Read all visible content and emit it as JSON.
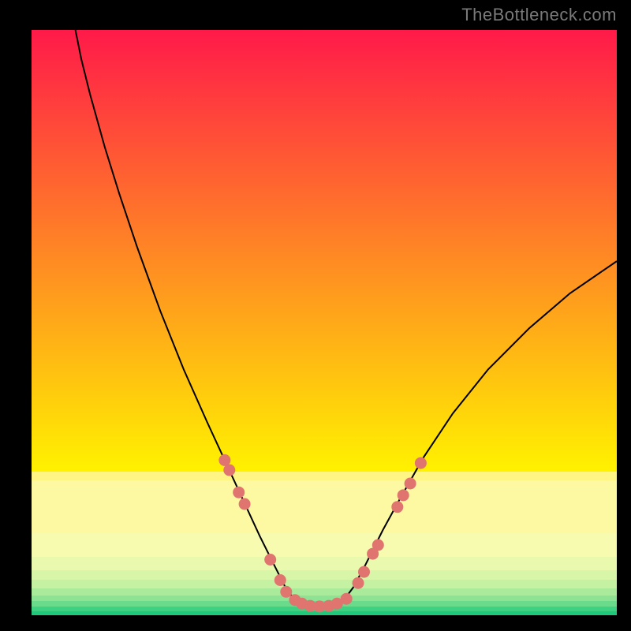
{
  "watermark": "TheBottleneck.com",
  "chart_data": {
    "type": "line",
    "title": "",
    "xlabel": "",
    "ylabel": "",
    "x_range": [
      0,
      100
    ],
    "ylim": [
      0,
      100
    ],
    "background_gradient_top": {
      "top_color": "#ff1a49",
      "bottom_color": "#fff200",
      "top_pct": 0,
      "bottom_pct": 75.5
    },
    "bottom_bands": [
      {
        "color": "#fff585",
        "top_pct": 75.5,
        "bottom_pct": 77.0
      },
      {
        "color": "#fdf9a3",
        "top_pct": 77.0,
        "bottom_pct": 86.0
      },
      {
        "color": "#f6fbb0",
        "top_pct": 86.0,
        "bottom_pct": 90.0
      },
      {
        "color": "#e9faae",
        "top_pct": 90.0,
        "bottom_pct": 92.3
      },
      {
        "color": "#d7f6a8",
        "top_pct": 92.3,
        "bottom_pct": 94.0
      },
      {
        "color": "#c4f2a2",
        "top_pct": 94.0,
        "bottom_pct": 95.4
      },
      {
        "color": "#aaea9b",
        "top_pct": 95.4,
        "bottom_pct": 96.6
      },
      {
        "color": "#8de393",
        "top_pct": 96.6,
        "bottom_pct": 97.6
      },
      {
        "color": "#6adb8b",
        "top_pct": 97.6,
        "bottom_pct": 98.5
      },
      {
        "color": "#3fd182",
        "top_pct": 98.5,
        "bottom_pct": 99.3
      },
      {
        "color": "#1fc97c",
        "top_pct": 99.3,
        "bottom_pct": 100
      }
    ],
    "series": [
      {
        "name": "bottleneck-curve",
        "color": "#000000",
        "stroke_width": 2.0,
        "points": [
          {
            "x": 7.5,
            "y": 100.0
          },
          {
            "x": 8.5,
            "y": 95.0
          },
          {
            "x": 10.0,
            "y": 89.0
          },
          {
            "x": 12.5,
            "y": 80.0
          },
          {
            "x": 15.0,
            "y": 72.0
          },
          {
            "x": 18.0,
            "y": 63.0
          },
          {
            "x": 22.0,
            "y": 52.0
          },
          {
            "x": 26.0,
            "y": 42.0
          },
          {
            "x": 30.0,
            "y": 33.0
          },
          {
            "x": 33.0,
            "y": 26.5
          },
          {
            "x": 36.0,
            "y": 20.0
          },
          {
            "x": 39.0,
            "y": 13.5
          },
          {
            "x": 41.5,
            "y": 8.5
          },
          {
            "x": 43.5,
            "y": 4.5
          },
          {
            "x": 45.0,
            "y": 2.6
          },
          {
            "x": 46.5,
            "y": 1.8
          },
          {
            "x": 48.0,
            "y": 1.5
          },
          {
            "x": 50.0,
            "y": 1.5
          },
          {
            "x": 52.0,
            "y": 1.8
          },
          {
            "x": 53.5,
            "y": 2.8
          },
          {
            "x": 55.0,
            "y": 4.8
          },
          {
            "x": 57.0,
            "y": 8.5
          },
          {
            "x": 60.0,
            "y": 14.5
          },
          {
            "x": 63.0,
            "y": 20.0
          },
          {
            "x": 67.0,
            "y": 27.0
          },
          {
            "x": 72.0,
            "y": 34.5
          },
          {
            "x": 78.0,
            "y": 42.0
          },
          {
            "x": 85.0,
            "y": 49.0
          },
          {
            "x": 92.0,
            "y": 55.0
          },
          {
            "x": 100.0,
            "y": 60.5
          }
        ]
      }
    ],
    "scatter": {
      "name": "data-points",
      "color": "#e0746f",
      "radius": 7.5,
      "points": [
        {
          "x": 33.0,
          "y": 26.5
        },
        {
          "x": 33.8,
          "y": 24.8
        },
        {
          "x": 35.4,
          "y": 21.0
        },
        {
          "x": 36.4,
          "y": 19.0
        },
        {
          "x": 40.8,
          "y": 9.5
        },
        {
          "x": 42.5,
          "y": 6.0
        },
        {
          "x": 43.5,
          "y": 4.0
        },
        {
          "x": 45.0,
          "y": 2.6
        },
        {
          "x": 46.2,
          "y": 2.0
        },
        {
          "x": 47.6,
          "y": 1.6
        },
        {
          "x": 49.2,
          "y": 1.5
        },
        {
          "x": 50.8,
          "y": 1.6
        },
        {
          "x": 52.2,
          "y": 2.0
        },
        {
          "x": 53.8,
          "y": 2.8
        },
        {
          "x": 55.8,
          "y": 5.5
        },
        {
          "x": 56.8,
          "y": 7.4
        },
        {
          "x": 58.3,
          "y": 10.5
        },
        {
          "x": 59.2,
          "y": 12.0
        },
        {
          "x": 62.5,
          "y": 18.5
        },
        {
          "x": 63.5,
          "y": 20.5
        },
        {
          "x": 64.7,
          "y": 22.5
        },
        {
          "x": 66.5,
          "y": 26.0
        }
      ]
    }
  }
}
